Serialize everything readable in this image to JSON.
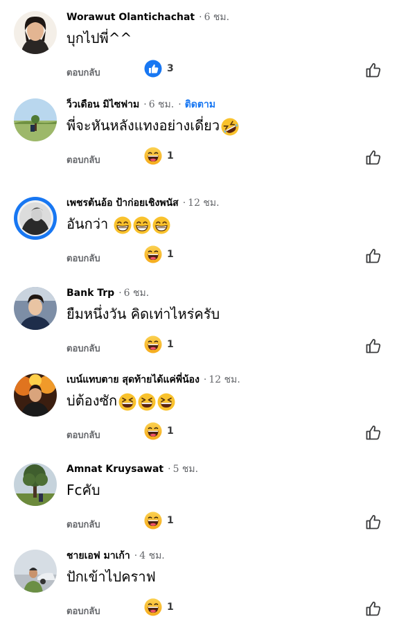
{
  "comments": [
    {
      "author": "Worawut Olantichachat",
      "time": "6 ชม.",
      "text": "บุกไปพี่^^",
      "emoji_suffix": "",
      "reply_label": "ตอบกลับ",
      "reaction": "like-reaction",
      "reaction_count": "3"
    },
    {
      "author": "ว็วเดือน มิไซฟาม",
      "time": "6 ชม.",
      "follow_label": "ติดตาม",
      "text": "พี่จะหันหลังแทงอย่างเดี่ยว",
      "emoji_suffix": "rolling-laugh",
      "reply_label": "ตอบกลับ",
      "reaction": "haha-reaction",
      "reaction_count": "1"
    },
    {
      "author": "เพชรต้นอ้อ ป้าก่อยเชิงพนัส",
      "time": "12 ชม.",
      "text": "อันกว่า",
      "emoji_suffix": "grin x3",
      "reply_label": "ตอบกลับ",
      "reaction": "haha-reaction",
      "reaction_count": "1"
    },
    {
      "author": "Bank Trp",
      "time": "6 ชม.",
      "text": "ยืมหนึ่งวัน คิดเท่าไหร่ครับ",
      "emoji_suffix": "",
      "reply_label": "ตอบกลับ",
      "reaction": "haha-reaction",
      "reaction_count": "1"
    },
    {
      "author": "เบน์แทบตาย สุดท้ายได้แค่พี่น้อง",
      "time": "12 ชม.",
      "text": "บ่ต้องซัก",
      "emoji_suffix": "squint-laugh x3",
      "reply_label": "ตอบกลับ",
      "reaction": "haha-reaction",
      "reaction_count": "1"
    },
    {
      "author": "Amnat Kruysawat",
      "time": "5 ชม.",
      "text": "Fcคับ",
      "emoji_suffix": "",
      "reply_label": "ตอบกลับ",
      "reaction": "haha-reaction",
      "reaction_count": "1"
    },
    {
      "author": "ชายเอฟ มาเก้า",
      "time": "4 ชม.",
      "text": "ปักเข้าไปคราฟ",
      "emoji_suffix": "",
      "reply_label": "ตอบกลับ",
      "reaction": "haha-reaction",
      "reaction_count": "1"
    }
  ],
  "colors": {
    "link": "#1877f2",
    "meta": "#65676b",
    "text": "#050505",
    "haha": "#f7b125"
  }
}
